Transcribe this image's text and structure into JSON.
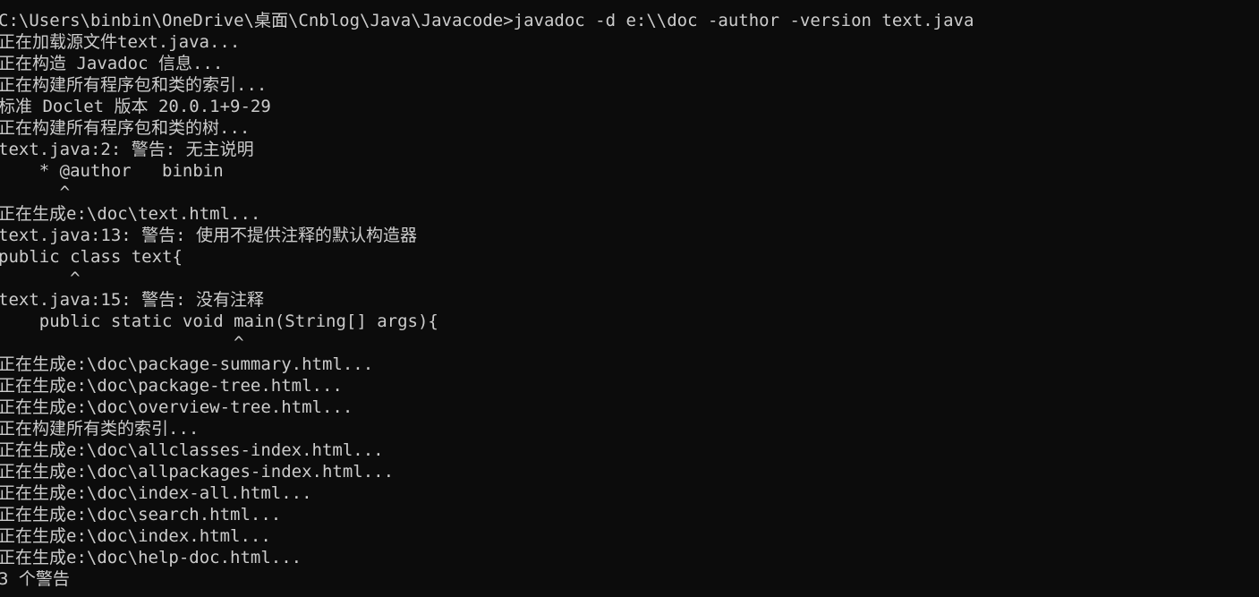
{
  "console": {
    "lines": [
      "C:\\Users\\binbin\\OneDrive\\桌面\\Cnblog\\Java\\Javacode>javadoc -d e:\\\\doc -author -version text.java",
      "正在加载源文件text.java...",
      "正在构造 Javadoc 信息...",
      "正在构建所有程序包和类的索引...",
      "标准 Doclet 版本 20.0.1+9-29",
      "正在构建所有程序包和类的树...",
      "text.java:2: 警告: 无主说明",
      "    * @author   binbin",
      "      ^",
      "正在生成e:\\doc\\text.html...",
      "text.java:13: 警告: 使用不提供注释的默认构造器",
      "public class text{",
      "       ^",
      "text.java:15: 警告: 没有注释",
      "    public static void main(String[] args){",
      "                       ^",
      "正在生成e:\\doc\\package-summary.html...",
      "正在生成e:\\doc\\package-tree.html...",
      "正在生成e:\\doc\\overview-tree.html...",
      "正在构建所有类的索引...",
      "正在生成e:\\doc\\allclasses-index.html...",
      "正在生成e:\\doc\\allpackages-index.html...",
      "正在生成e:\\doc\\index-all.html...",
      "正在生成e:\\doc\\search.html...",
      "正在生成e:\\doc\\index.html...",
      "正在生成e:\\doc\\help-doc.html...",
      "3 个警告"
    ],
    "background": "#0c0c0c",
    "foreground": "#cccccc"
  }
}
